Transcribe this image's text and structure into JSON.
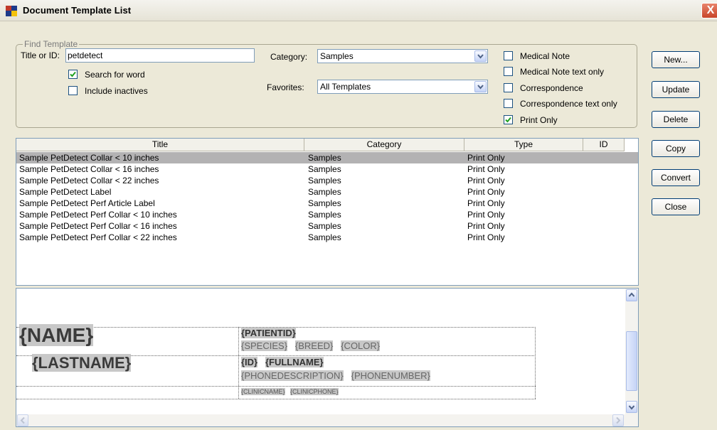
{
  "window": {
    "title": "Document Template List",
    "close_glyph": "X"
  },
  "find": {
    "legend": "Find Template",
    "title_label": "Title or ID:",
    "title_value": "petdetect",
    "search_for_word_label": "Search for word",
    "search_for_word_checked": true,
    "include_inactives_label": "Include inactives",
    "include_inactives_checked": false,
    "category_label": "Category:",
    "category_value": "Samples",
    "favorites_label": "Favorites:",
    "favorites_value": "All Templates",
    "types": [
      {
        "label": "Medical Note",
        "checked": false
      },
      {
        "label": "Medical Note text only",
        "checked": false
      },
      {
        "label": "Correspondence",
        "checked": false
      },
      {
        "label": "Correspondence text only",
        "checked": false
      },
      {
        "label": "Print Only",
        "checked": true
      }
    ]
  },
  "buttons": [
    "New...",
    "Update",
    "Delete",
    "Copy",
    "Convert",
    "Close"
  ],
  "table": {
    "columns": [
      "Title",
      "Category",
      "Type",
      "ID"
    ],
    "rows": [
      {
        "title": "Sample PetDetect Collar < 10 inches",
        "category": "Samples",
        "type": "Print Only",
        "id": ""
      },
      {
        "title": "Sample PetDetect Collar < 16 inches",
        "category": "Samples",
        "type": "Print Only",
        "id": ""
      },
      {
        "title": "Sample PetDetect Collar < 22 inches",
        "category": "Samples",
        "type": "Print Only",
        "id": ""
      },
      {
        "title": "Sample PetDetect Label",
        "category": "Samples",
        "type": "Print Only",
        "id": ""
      },
      {
        "title": "Sample PetDetect Perf Article Label",
        "category": "Samples",
        "type": "Print Only",
        "id": ""
      },
      {
        "title": "Sample PetDetect Perf Collar < 10 inches",
        "category": "Samples",
        "type": "Print Only",
        "id": ""
      },
      {
        "title": "Sample PetDetect Perf Collar < 16 inches",
        "category": "Samples",
        "type": "Print Only",
        "id": ""
      },
      {
        "title": "Sample PetDetect Perf Collar < 22 inches",
        "category": "Samples",
        "type": "Print Only",
        "id": ""
      }
    ],
    "selected_index": 0
  },
  "preview": {
    "name": "{NAME}",
    "lastname": "{LASTNAME}",
    "patientid": "{PATIENTID}",
    "species": "{SPECIES}",
    "breed": "{BREED}",
    "color": "{COLOR}",
    "id": "{ID}",
    "fullname": "{FULLNAME}",
    "phonedescription": "{PHONEDESCRIPTION}",
    "phonenumber": "{PHONENUMBER}",
    "clinicname": "{CLINICNAME}",
    "clinicphone": "{CLINICPHONE}"
  },
  "colors": {
    "selection": "#b3b2b3",
    "window_bg": "#ece9d8",
    "check": "#21a121"
  }
}
